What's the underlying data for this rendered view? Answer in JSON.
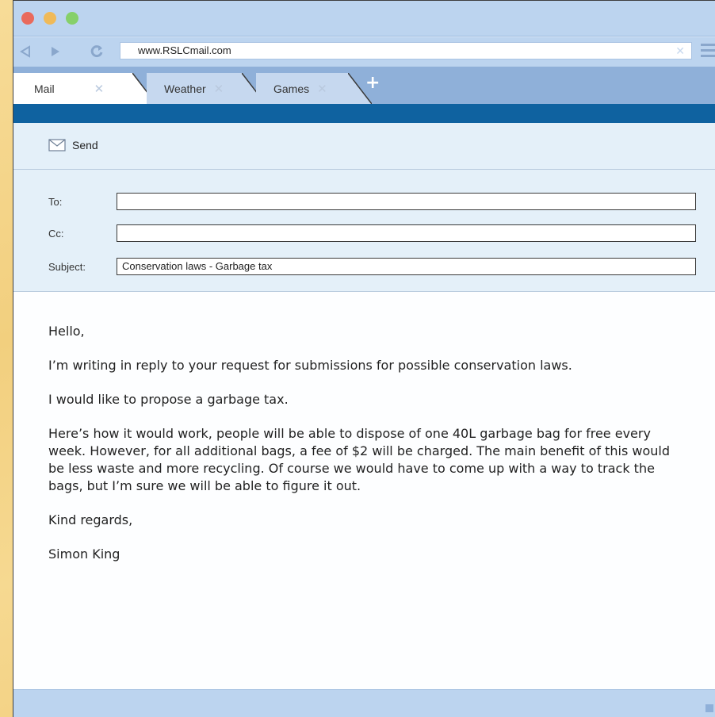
{
  "browser": {
    "url": "www.RSLCmail.com",
    "tabs": [
      {
        "label": "Mail",
        "active": true
      },
      {
        "label": "Weather",
        "active": false
      },
      {
        "label": "Games",
        "active": false
      }
    ],
    "dots": {
      "red": "#e96a5c",
      "yellow": "#f0ba58",
      "green": "#86d06a"
    }
  },
  "toolbar": {
    "send_label": "Send"
  },
  "fields": {
    "to_label": "To:",
    "cc_label": "Cc:",
    "subject_label": "Subject:",
    "to_value": "",
    "cc_value": "",
    "subject_value": "Conservation laws - Garbage tax"
  },
  "message": {
    "greeting": "Hello,",
    "para1": "I’m writing in reply to your request for submissions for possible conservation laws.",
    "para2": "I would like to propose a garbage tax.",
    "para3": "Here’s how it would work, people will be able to dispose of one 40L garbage bag for free every week. However, for all additional bags, a fee of $2 will be charged. The main benefit of this would be less waste and more recycling. Of course we would have to come up with a way to track the bags, but I’m sure we will be able to figure it out.",
    "closing": "Kind regards,",
    "signature": "Simon King"
  }
}
